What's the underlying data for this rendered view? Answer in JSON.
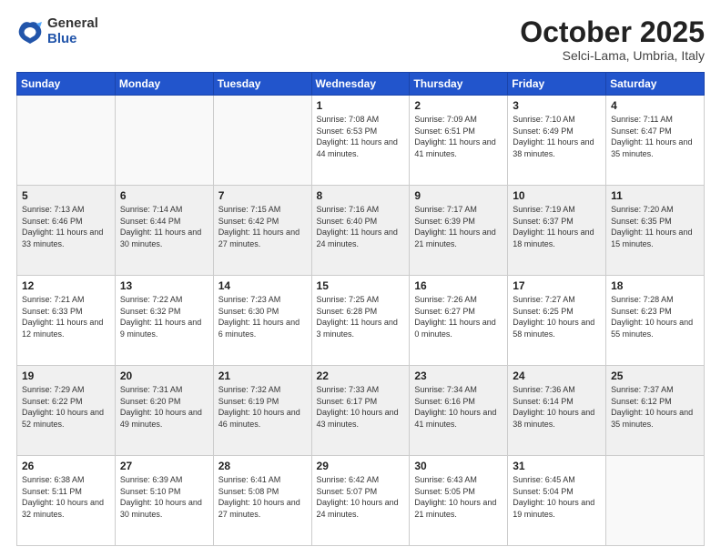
{
  "logo": {
    "general": "General",
    "blue": "Blue"
  },
  "header": {
    "month": "October 2025",
    "location": "Selci-Lama, Umbria, Italy"
  },
  "weekdays": [
    "Sunday",
    "Monday",
    "Tuesday",
    "Wednesday",
    "Thursday",
    "Friday",
    "Saturday"
  ],
  "weeks": [
    [
      {
        "day": "",
        "info": ""
      },
      {
        "day": "",
        "info": ""
      },
      {
        "day": "",
        "info": ""
      },
      {
        "day": "1",
        "info": "Sunrise: 7:08 AM\nSunset: 6:53 PM\nDaylight: 11 hours\nand 44 minutes."
      },
      {
        "day": "2",
        "info": "Sunrise: 7:09 AM\nSunset: 6:51 PM\nDaylight: 11 hours\nand 41 minutes."
      },
      {
        "day": "3",
        "info": "Sunrise: 7:10 AM\nSunset: 6:49 PM\nDaylight: 11 hours\nand 38 minutes."
      },
      {
        "day": "4",
        "info": "Sunrise: 7:11 AM\nSunset: 6:47 PM\nDaylight: 11 hours\nand 35 minutes."
      }
    ],
    [
      {
        "day": "5",
        "info": "Sunrise: 7:13 AM\nSunset: 6:46 PM\nDaylight: 11 hours\nand 33 minutes."
      },
      {
        "day": "6",
        "info": "Sunrise: 7:14 AM\nSunset: 6:44 PM\nDaylight: 11 hours\nand 30 minutes."
      },
      {
        "day": "7",
        "info": "Sunrise: 7:15 AM\nSunset: 6:42 PM\nDaylight: 11 hours\nand 27 minutes."
      },
      {
        "day": "8",
        "info": "Sunrise: 7:16 AM\nSunset: 6:40 PM\nDaylight: 11 hours\nand 24 minutes."
      },
      {
        "day": "9",
        "info": "Sunrise: 7:17 AM\nSunset: 6:39 PM\nDaylight: 11 hours\nand 21 minutes."
      },
      {
        "day": "10",
        "info": "Sunrise: 7:19 AM\nSunset: 6:37 PM\nDaylight: 11 hours\nand 18 minutes."
      },
      {
        "day": "11",
        "info": "Sunrise: 7:20 AM\nSunset: 6:35 PM\nDaylight: 11 hours\nand 15 minutes."
      }
    ],
    [
      {
        "day": "12",
        "info": "Sunrise: 7:21 AM\nSunset: 6:33 PM\nDaylight: 11 hours\nand 12 minutes."
      },
      {
        "day": "13",
        "info": "Sunrise: 7:22 AM\nSunset: 6:32 PM\nDaylight: 11 hours\nand 9 minutes."
      },
      {
        "day": "14",
        "info": "Sunrise: 7:23 AM\nSunset: 6:30 PM\nDaylight: 11 hours\nand 6 minutes."
      },
      {
        "day": "15",
        "info": "Sunrise: 7:25 AM\nSunset: 6:28 PM\nDaylight: 11 hours\nand 3 minutes."
      },
      {
        "day": "16",
        "info": "Sunrise: 7:26 AM\nSunset: 6:27 PM\nDaylight: 11 hours\nand 0 minutes."
      },
      {
        "day": "17",
        "info": "Sunrise: 7:27 AM\nSunset: 6:25 PM\nDaylight: 10 hours\nand 58 minutes."
      },
      {
        "day": "18",
        "info": "Sunrise: 7:28 AM\nSunset: 6:23 PM\nDaylight: 10 hours\nand 55 minutes."
      }
    ],
    [
      {
        "day": "19",
        "info": "Sunrise: 7:29 AM\nSunset: 6:22 PM\nDaylight: 10 hours\nand 52 minutes."
      },
      {
        "day": "20",
        "info": "Sunrise: 7:31 AM\nSunset: 6:20 PM\nDaylight: 10 hours\nand 49 minutes."
      },
      {
        "day": "21",
        "info": "Sunrise: 7:32 AM\nSunset: 6:19 PM\nDaylight: 10 hours\nand 46 minutes."
      },
      {
        "day": "22",
        "info": "Sunrise: 7:33 AM\nSunset: 6:17 PM\nDaylight: 10 hours\nand 43 minutes."
      },
      {
        "day": "23",
        "info": "Sunrise: 7:34 AM\nSunset: 6:16 PM\nDaylight: 10 hours\nand 41 minutes."
      },
      {
        "day": "24",
        "info": "Sunrise: 7:36 AM\nSunset: 6:14 PM\nDaylight: 10 hours\nand 38 minutes."
      },
      {
        "day": "25",
        "info": "Sunrise: 7:37 AM\nSunset: 6:12 PM\nDaylight: 10 hours\nand 35 minutes."
      }
    ],
    [
      {
        "day": "26",
        "info": "Sunrise: 6:38 AM\nSunset: 5:11 PM\nDaylight: 10 hours\nand 32 minutes."
      },
      {
        "day": "27",
        "info": "Sunrise: 6:39 AM\nSunset: 5:10 PM\nDaylight: 10 hours\nand 30 minutes."
      },
      {
        "day": "28",
        "info": "Sunrise: 6:41 AM\nSunset: 5:08 PM\nDaylight: 10 hours\nand 27 minutes."
      },
      {
        "day": "29",
        "info": "Sunrise: 6:42 AM\nSunset: 5:07 PM\nDaylight: 10 hours\nand 24 minutes."
      },
      {
        "day": "30",
        "info": "Sunrise: 6:43 AM\nSunset: 5:05 PM\nDaylight: 10 hours\nand 21 minutes."
      },
      {
        "day": "31",
        "info": "Sunrise: 6:45 AM\nSunset: 5:04 PM\nDaylight: 10 hours\nand 19 minutes."
      },
      {
        "day": "",
        "info": ""
      }
    ]
  ]
}
